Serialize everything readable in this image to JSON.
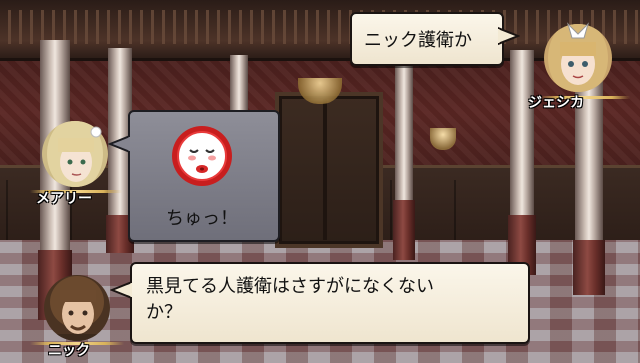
{
  "dialogue": {
    "jessica": {
      "name": "ジェシカ",
      "line": "ニック護衛か"
    },
    "mary": {
      "name": "メアリー",
      "line": "ちゅっ！",
      "emote_icon": "kiss-face-icon"
    },
    "nick": {
      "name": "ニック",
      "line": "黒見てる人護衛はさすがになくない\nか？"
    }
  },
  "colors": {
    "bubble_fill": "#f6efdc",
    "emote_bubble_fill": "#7c7c86",
    "emote_red": "#d62828",
    "name_text": "#ffffff"
  }
}
